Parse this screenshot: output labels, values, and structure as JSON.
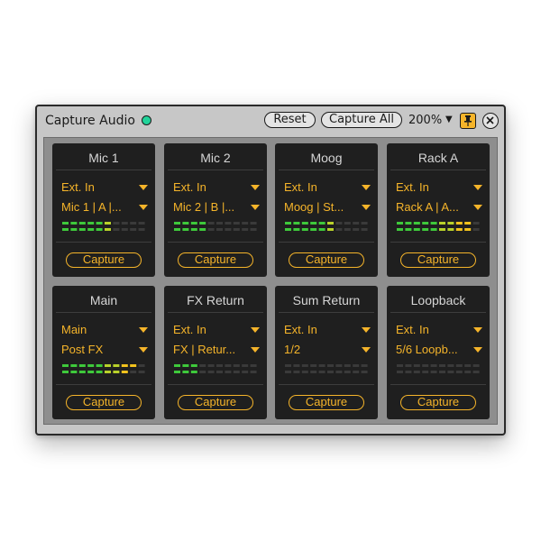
{
  "window": {
    "title": "Capture Audio",
    "status_color": "#22d39a",
    "buttons": {
      "reset": "Reset",
      "capture_all": "Capture All"
    },
    "zoom": "200%"
  },
  "accent": "#f5b42a",
  "channels": [
    {
      "name": "Mic 1",
      "input": "Ext. In",
      "source": "Mic 1 | A |...",
      "capture": "Capture",
      "meter_top": 0.6,
      "meter_bottom": 0.6
    },
    {
      "name": "Mic 2",
      "input": "Ext. In",
      "source": "Mic 2 | B |...",
      "capture": "Capture",
      "meter_top": 0.4,
      "meter_bottom": 0.4
    },
    {
      "name": "Moog",
      "input": "Ext. In",
      "source": "Moog | St...",
      "capture": "Capture",
      "meter_top": 0.6,
      "meter_bottom": 0.6
    },
    {
      "name": "Rack A",
      "input": "Ext. In",
      "source": "Rack A | A...",
      "capture": "Capture",
      "meter_top": 0.9,
      "meter_bottom": 0.9
    },
    {
      "name": "Main",
      "input": "Main",
      "source": "Post FX",
      "capture": "Capture",
      "meter_top": 0.9,
      "meter_bottom": 0.8
    },
    {
      "name": "FX Return",
      "input": "Ext. In",
      "source": "FX | Retur...",
      "capture": "Capture",
      "meter_top": 0.3,
      "meter_bottom": 0.3
    },
    {
      "name": "Sum Return",
      "input": "Ext. In",
      "source": "1/2",
      "capture": "Capture",
      "meter_top": 0,
      "meter_bottom": 0
    },
    {
      "name": "Loopback",
      "input": "Ext. In",
      "source": "5/6 Loopb...",
      "capture": "Capture",
      "meter_top": 0,
      "meter_bottom": 0
    }
  ]
}
